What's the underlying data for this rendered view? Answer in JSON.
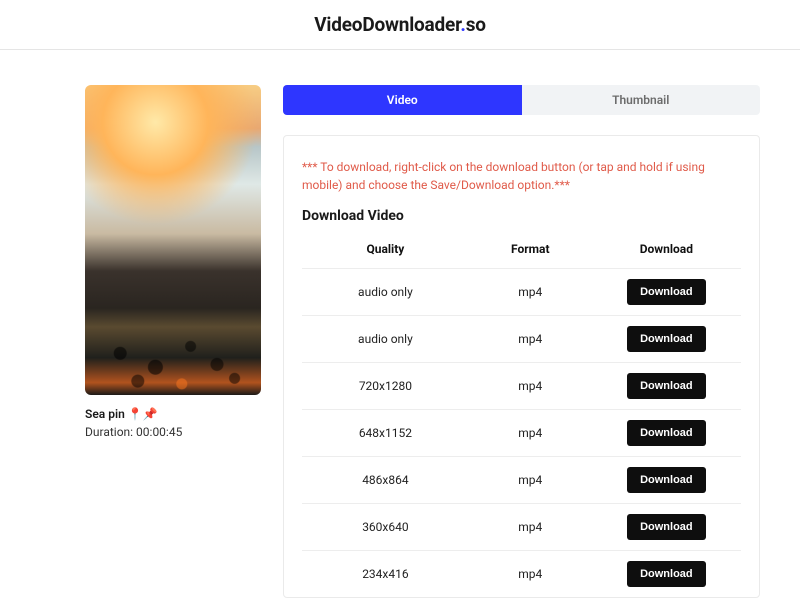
{
  "brand": {
    "name": "VideoDownloader",
    "suffix": "so"
  },
  "video": {
    "title": "Sea pin 📍📌",
    "duration_label": "Duration: 00:00:45"
  },
  "tabs": {
    "video": "Video",
    "thumbnail": "Thumbnail"
  },
  "panel": {
    "notice": "*** To download, right-click on the download button (or tap and hold if using mobile) and choose the Save/Download option.***",
    "section_title": "Download Video",
    "columns": {
      "quality": "Quality",
      "format": "Format",
      "download": "Download"
    },
    "download_button_label": "Download",
    "rows": [
      {
        "quality": "audio only",
        "format": "mp4"
      },
      {
        "quality": "audio only",
        "format": "mp4"
      },
      {
        "quality": "720x1280",
        "format": "mp4"
      },
      {
        "quality": "648x1152",
        "format": "mp4"
      },
      {
        "quality": "486x864",
        "format": "mp4"
      },
      {
        "quality": "360x640",
        "format": "mp4"
      },
      {
        "quality": "234x416",
        "format": "mp4"
      }
    ]
  }
}
